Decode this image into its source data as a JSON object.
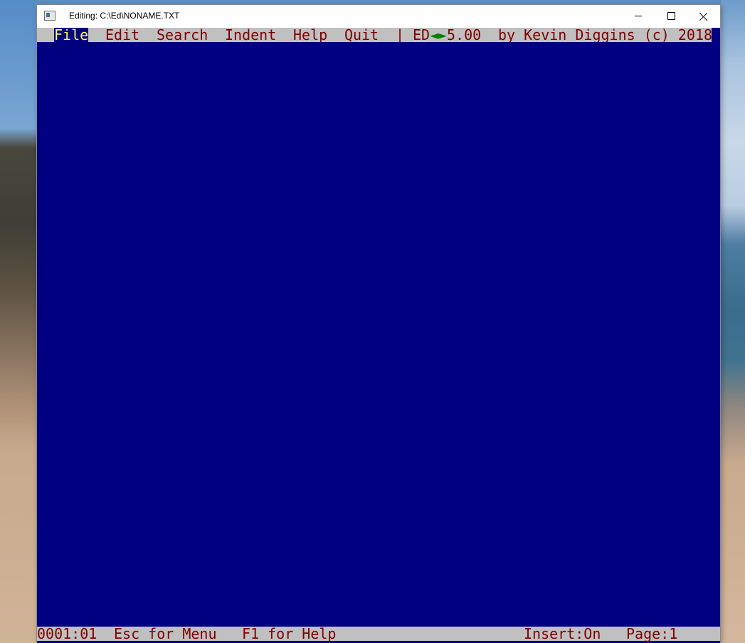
{
  "window": {
    "title": "Editing: C:\\Ed\\NONAME.TXT"
  },
  "menu": {
    "items": [
      "File",
      "Edit",
      "Search",
      "Indent",
      "Help",
      "Quit"
    ],
    "selected": "File",
    "separator": "|",
    "product": {
      "name": "ED",
      "arrows": "◄►",
      "version": "5.00",
      "credit": "by Kevin Diggins (c) 2018"
    }
  },
  "status": {
    "position": "0001:01",
    "esc_hint": "Esc for Menu",
    "f1_hint": "F1 for Help",
    "insert": "Insert:On",
    "page": "Page:1"
  },
  "colors": {
    "editor_background": "#000080",
    "bar_background": "#c0c0c0",
    "bar_text": "#800000",
    "selected_text": "#ffff55",
    "arrow_color": "#008000"
  },
  "icons": [
    "app-icon",
    "minimize-icon",
    "maximize-icon",
    "close-icon"
  ]
}
